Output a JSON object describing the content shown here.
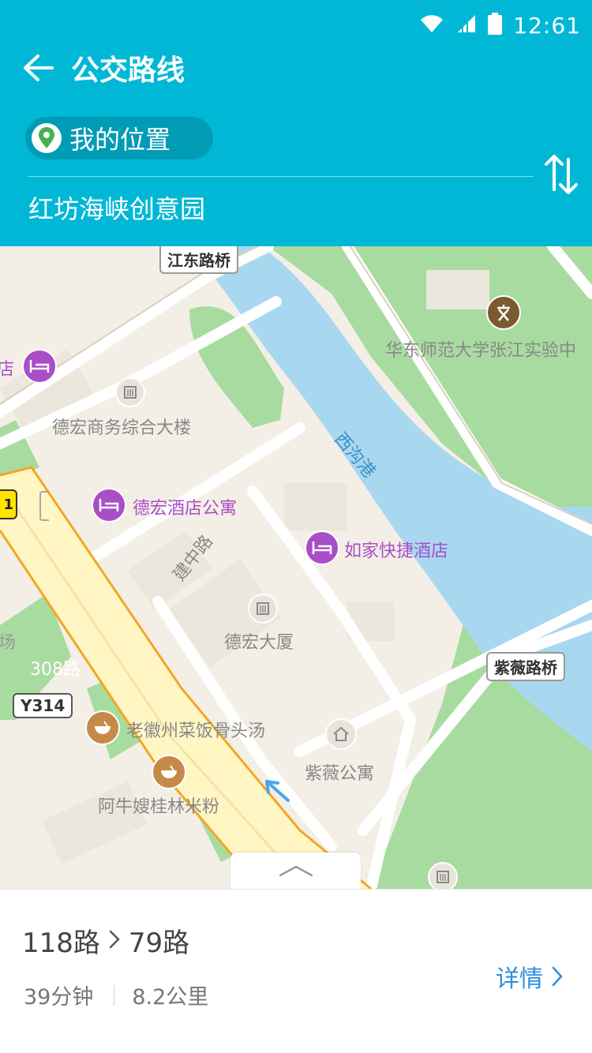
{
  "status_bar": {
    "time": "12:61"
  },
  "header": {
    "title": "公交路线",
    "origin": "我的位置",
    "destination": "红坊海峡创意园"
  },
  "map": {
    "labels": {
      "bridge_jiangdong": "江东路桥",
      "school": "华东师范大学张江实验中",
      "river": "西沟港",
      "hotel_left": "店",
      "dehong_business": "德宏商务综合大楼",
      "dehong_hotel": "德宏酒店公寓",
      "rujia_hotel": "如家快捷酒店",
      "jianzhong_road": "建中路",
      "dehong_tower": "德宏大厦",
      "field": "场",
      "bus_308": "308路",
      "ziwei_bridge": "紫薇路桥",
      "road_y314": "Y314",
      "laohuizhou": "老徽州菜饭骨头汤",
      "ziwei_apartment": "紫薇公寓",
      "aniu_noodle": "阿牛嫂桂林米粉",
      "yellow_tag": "1"
    }
  },
  "route": {
    "first_line": "118路",
    "separator": ">",
    "second_line": "79路",
    "duration": "39分钟",
    "distance": "8.2公里",
    "details_label": "详情"
  },
  "colors": {
    "header_bg": "#00b8d6",
    "river": "#a8d8f0",
    "park": "#a8dba0",
    "road_main": "#fff6c4",
    "road_border": "#f5a623",
    "poi_hotel": "#a84fc8",
    "poi_food": "#c58a4a",
    "link": "#2d8ee0"
  }
}
